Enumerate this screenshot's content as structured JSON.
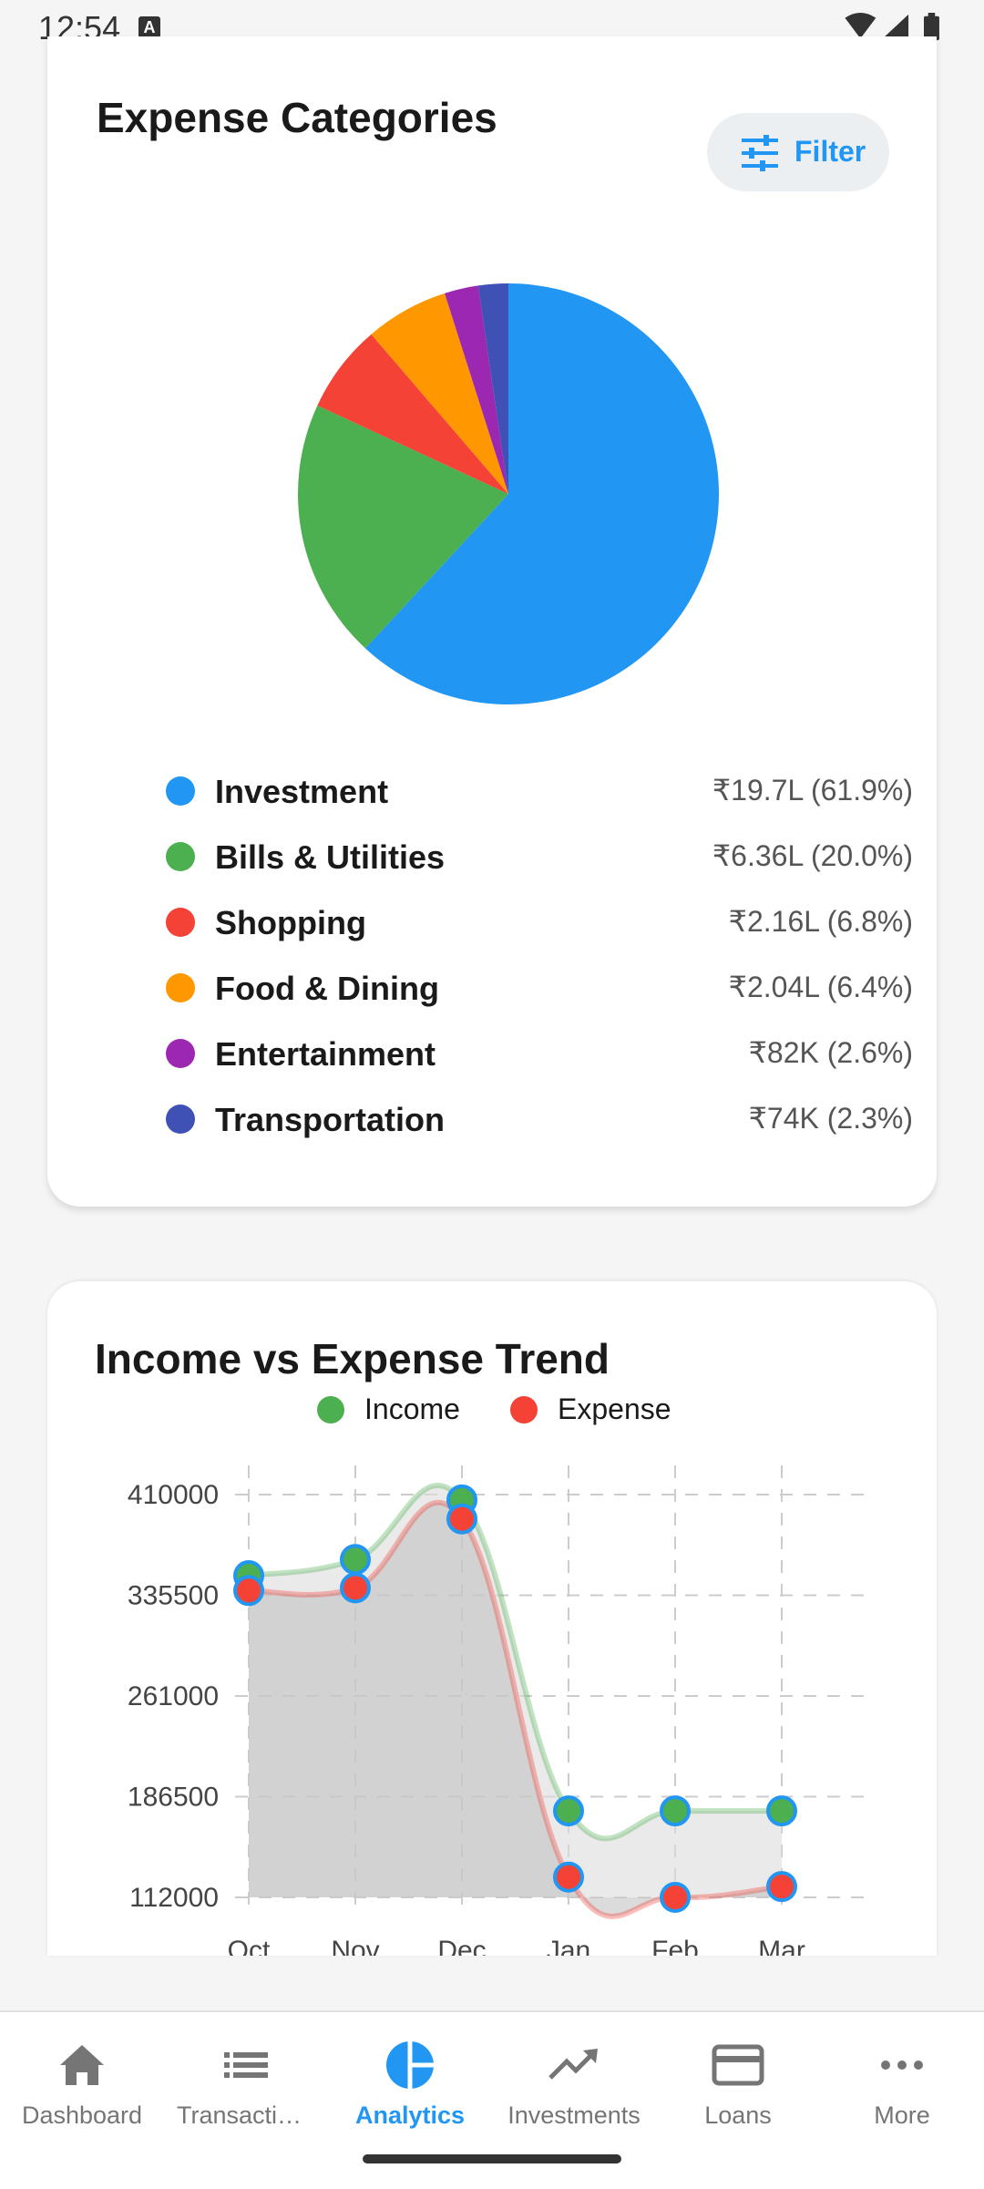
{
  "status_bar": {
    "time": "12:54",
    "notification_icon": "A"
  },
  "expense_card": {
    "title": "Expense Categories",
    "filter_label": "Filter",
    "categories": [
      {
        "name": "Investment",
        "value": "₹19.7L (61.9%)",
        "percent": 61.9,
        "color": "#2196f3"
      },
      {
        "name": "Bills & Utilities",
        "value": "₹6.36L (20.0%)",
        "percent": 20.0,
        "color": "#4caf50"
      },
      {
        "name": "Shopping",
        "value": "₹2.16L (6.8%)",
        "percent": 6.8,
        "color": "#f44336"
      },
      {
        "name": "Food & Dining",
        "value": "₹2.04L (6.4%)",
        "percent": 6.4,
        "color": "#ff9800"
      },
      {
        "name": "Entertainment",
        "value": "₹82K (2.6%)",
        "percent": 2.6,
        "color": "#9c27b0"
      },
      {
        "name": "Transportation",
        "value": "₹74K (2.3%)",
        "percent": 2.3,
        "color": "#3f51b5"
      }
    ]
  },
  "trend_card": {
    "title": "Income vs Expense Trend",
    "legend": [
      {
        "label": "Income",
        "color": "#4caf50"
      },
      {
        "label": "Expense",
        "color": "#f44336"
      }
    ]
  },
  "chart_data": [
    {
      "type": "pie",
      "title": "Expense Categories",
      "categories": [
        "Investment",
        "Bills & Utilities",
        "Shopping",
        "Food & Dining",
        "Entertainment",
        "Transportation"
      ],
      "values": [
        61.9,
        20.0,
        6.8,
        6.4,
        2.6,
        2.3
      ]
    },
    {
      "type": "area",
      "title": "Income vs Expense Trend",
      "categories": [
        "Oct",
        "Nov",
        "Dec",
        "Jan",
        "Feb",
        "Mar"
      ],
      "series": [
        {
          "name": "Income",
          "values": [
            350000,
            362000,
            406000,
            176000,
            176000,
            176000
          ]
        },
        {
          "name": "Expense",
          "values": [
            339000,
            341000,
            392000,
            127000,
            112000,
            120000
          ]
        }
      ],
      "yticks": [
        "410000",
        "335500",
        "261000",
        "186500",
        "112000"
      ],
      "ylim": [
        112000,
        410000
      ],
      "grid": true,
      "legend": "top"
    }
  ],
  "bottom_nav": {
    "items": [
      {
        "label": "Dashboard",
        "icon": "home-icon",
        "active": false
      },
      {
        "label": "Transactions",
        "icon": "list-icon",
        "active": false
      },
      {
        "label": "Analytics",
        "icon": "pie-chart-icon",
        "active": true
      },
      {
        "label": "Investments",
        "icon": "trending-up-icon",
        "active": false
      },
      {
        "label": "Loans",
        "icon": "credit-card-icon",
        "active": false
      },
      {
        "label": "More",
        "icon": "more-horizontal-icon",
        "active": false
      }
    ],
    "active_color": "#2196f3",
    "inactive_color": "#757575"
  }
}
